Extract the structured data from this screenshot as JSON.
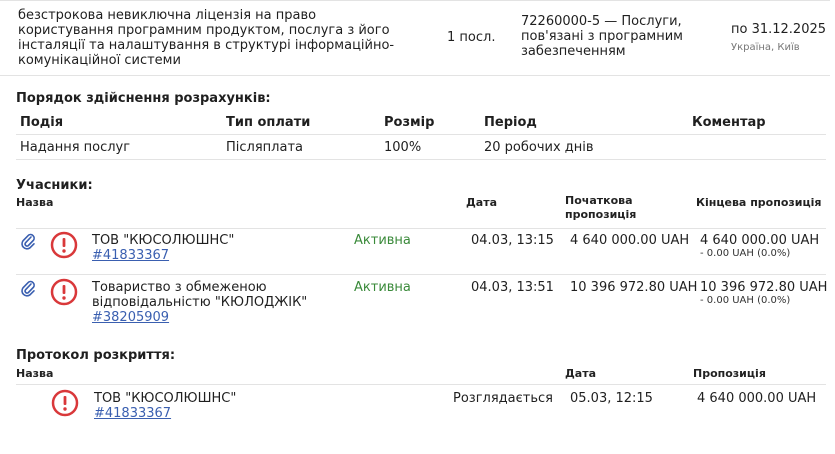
{
  "item_row": {
    "description": "безстрокова невиключна ліцензія на право користування програмним продуктом, послуга з його інсталяції та налаштування в структурі інформаційно-комунікаційної системи",
    "quantity": "1 посл.",
    "classifier": "72260000-5 — Послуги, пов'язані з програмним забезпеченням",
    "delivery_date": "по 31.12.2025",
    "delivery_place": "Україна, Київ"
  },
  "payment": {
    "title": "Порядок здійснення розрахунків:",
    "headers": {
      "event": "Подія",
      "type": "Тип оплати",
      "size": "Розмір",
      "period": "Період",
      "comment": "Коментар"
    },
    "row": {
      "event": "Надання послуг",
      "type": "Післяплата",
      "size": "100%",
      "period": "20 робочих днів",
      "comment": ""
    }
  },
  "participants": {
    "title": "Учасники:",
    "headers": {
      "name": "Назва",
      "date": "Дата",
      "initial": "Початкова пропозиція",
      "final": "Кінцева пропозиція"
    },
    "rows": [
      {
        "name": "ТОВ \"КЮСОЛЮШНС\"",
        "code": "#41833367",
        "status": "Активна",
        "date": "04.03, 13:15",
        "initial": "4 640 000.00 UAH",
        "final": "4 640 000.00 UAH",
        "diff": "- 0.00 UAH (0.0%)"
      },
      {
        "name_line1": "Товариство з обмеженою",
        "name_line2": "відповідальністю \"КЮЛОДЖІК\"",
        "code": "#38205909",
        "status": "Активна",
        "date": "04.03, 13:51",
        "initial": "10 396 972.80 UAH",
        "final": "10 396 972.80 UAH",
        "diff": "- 0.00 UAH (0.0%)"
      }
    ]
  },
  "protocol": {
    "title": "Протокол розкриття:",
    "headers": {
      "name": "Назва",
      "date": "Дата",
      "offer": "Пропозиція"
    },
    "row": {
      "name": "ТОВ \"КЮСОЛЮШНС\"",
      "code": "#41833367",
      "status": "Розглядається",
      "date": "05.03, 12:15",
      "offer": "4 640 000.00 UAH"
    }
  },
  "colors": {
    "warning": "#d9383a",
    "link": "#3a5fb0",
    "active": "#3a8a3a",
    "clip": "#3a5fb0"
  }
}
